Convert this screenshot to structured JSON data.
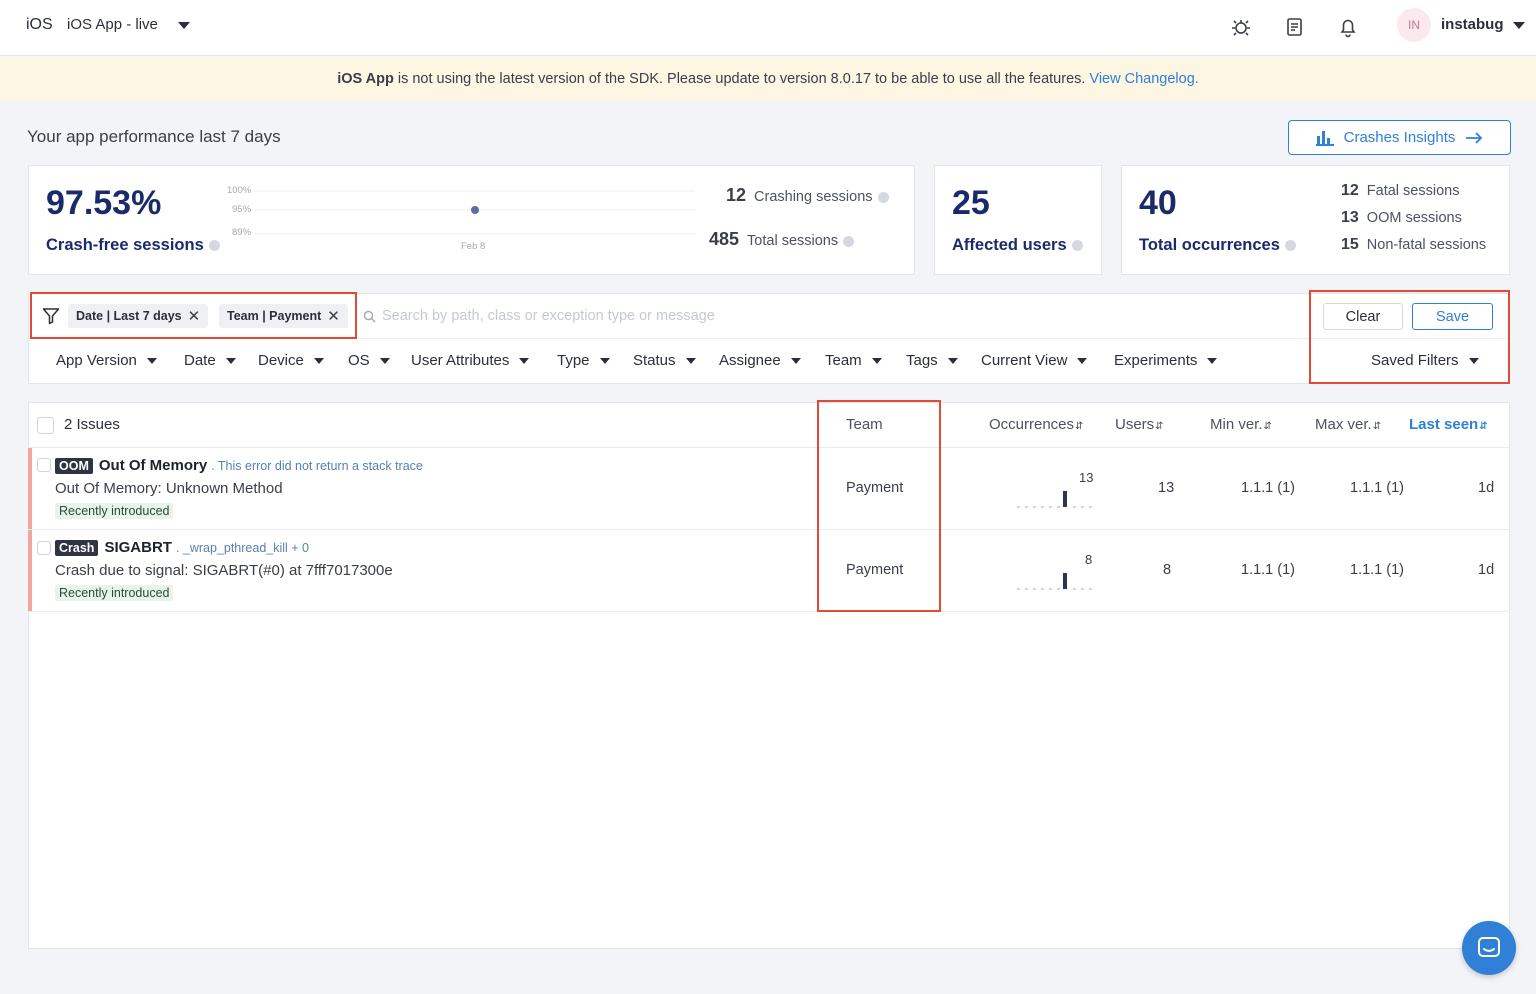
{
  "header": {
    "platform": "iOS",
    "app_name": "iOS App - live",
    "user_initials": "IN",
    "user_name": "instabug",
    "icons": [
      "bug-icon",
      "document-icon",
      "bell-icon"
    ]
  },
  "banner": {
    "app": "iOS App",
    "message": "is not using the latest version of the SDK. Please update to version 8.0.17 to be able to use all the features.",
    "link": "View Changelog."
  },
  "performance": {
    "title": "Your app performance last 7 days",
    "insights_button": "Crashes Insights",
    "crash_free": {
      "value": "97.53%",
      "label": "Crash-free sessions",
      "chart_ticks": [
        "100%",
        "95%",
        "89%"
      ],
      "chart_date": "Feb 8",
      "crashing_sessions": "12",
      "crashing_label": "Crashing sessions",
      "total_sessions": "485",
      "total_label": "Total sessions"
    },
    "affected_users": {
      "value": "25",
      "label": "Affected users"
    },
    "occurrences": {
      "value": "40",
      "label": "Total occurrences",
      "breakdown": [
        {
          "n": "12",
          "label": "Fatal sessions"
        },
        {
          "n": "13",
          "label": "OOM sessions"
        },
        {
          "n": "15",
          "label": "Non-fatal sessions"
        }
      ]
    }
  },
  "filters": {
    "chips": [
      {
        "label": "Date | Last 7 days"
      },
      {
        "label": "Team | Payment"
      }
    ],
    "search_placeholder": "Search by path, class or exception type or message",
    "clear_label": "Clear",
    "save_label": "Save",
    "dropdowns": [
      "App Version",
      "Date",
      "Device",
      "OS",
      "User Attributes",
      "Type",
      "Status",
      "Assignee",
      "Team",
      "Tags",
      "Current View",
      "Experiments"
    ],
    "saved_filters": "Saved Filters"
  },
  "table": {
    "issues_count": "2 Issues",
    "columns": {
      "team": "Team",
      "occurrences": "Occurrences",
      "users": "Users",
      "min_ver": "Min ver.",
      "max_ver": "Max ver.",
      "last_seen": "Last seen"
    },
    "rows": [
      {
        "tag": "OOM",
        "title": "Out Of Memory",
        "subtitle": ". This error did not return a stack trace",
        "description": "Out Of Memory: Unknown Method",
        "badge": "Recently introduced",
        "team": "Payment",
        "occurrences": "13",
        "users": "13",
        "min_ver": "1.1.1 (1)",
        "max_ver": "1.1.1 (1)",
        "last_seen": "1d"
      },
      {
        "tag": "Crash",
        "title": "SIGABRT",
        "subtitle": ". _wrap_pthread_kill + 0",
        "description": "Crash due to signal: SIGABRT(#0) at 7fff7017300e",
        "badge": "Recently introduced",
        "team": "Payment",
        "occurrences": "8",
        "users": "8",
        "min_ver": "1.1.1 (1)",
        "max_ver": "1.1.1 (1)",
        "last_seen": "1d"
      }
    ]
  },
  "colors": {
    "accent": "#2f80d6",
    "navy": "#1b2a6b",
    "highlight": "#e14a35",
    "banner_bg": "#fdf6e3"
  }
}
